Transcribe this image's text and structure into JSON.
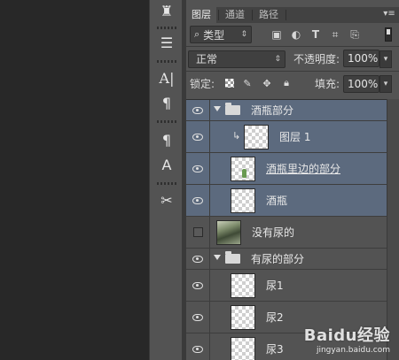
{
  "tabs": [
    {
      "label": "图层",
      "active": true
    },
    {
      "label": "通道",
      "active": false
    },
    {
      "label": "路径",
      "active": false
    }
  ],
  "filter": {
    "kind_label": "类型",
    "icons": [
      "image-filter-icon",
      "adjustment-filter-icon",
      "type-filter-icon",
      "shape-filter-icon",
      "smart-object-filter-icon"
    ]
  },
  "blend": {
    "mode": "正常",
    "opacity_label": "不透明度:",
    "opacity_value": "100%"
  },
  "lock": {
    "label": "锁定:",
    "fill_label": "填充:",
    "fill_value": "100%"
  },
  "layers": [
    {
      "name": "酒瓶部分",
      "type": "group",
      "visible": true,
      "selected": true
    },
    {
      "name": "图层 1",
      "type": "layer",
      "visible": true,
      "selected": true,
      "clipped": true
    },
    {
      "name": "酒瓶里边的部分",
      "type": "layer",
      "visible": true,
      "selected": true
    },
    {
      "name": "酒瓶",
      "type": "layer",
      "visible": true,
      "selected": true
    },
    {
      "name": "没有尿的",
      "type": "layer",
      "visible": false,
      "selected": false
    },
    {
      "name": "有尿的部分",
      "type": "group",
      "visible": true,
      "selected": false
    },
    {
      "name": "尿1",
      "type": "layer",
      "visible": true,
      "selected": false
    },
    {
      "name": "尿2",
      "type": "layer",
      "visible": true,
      "selected": false
    },
    {
      "name": "尿3",
      "type": "layer",
      "visible": true,
      "selected": false
    }
  ],
  "watermark": {
    "main": "Baidu经验",
    "sub": "jingyan.baidu.com"
  },
  "colors": {
    "panel_bg": "#535353",
    "selected_row": "#5c6a7e",
    "canvas_bg": "#282828"
  }
}
